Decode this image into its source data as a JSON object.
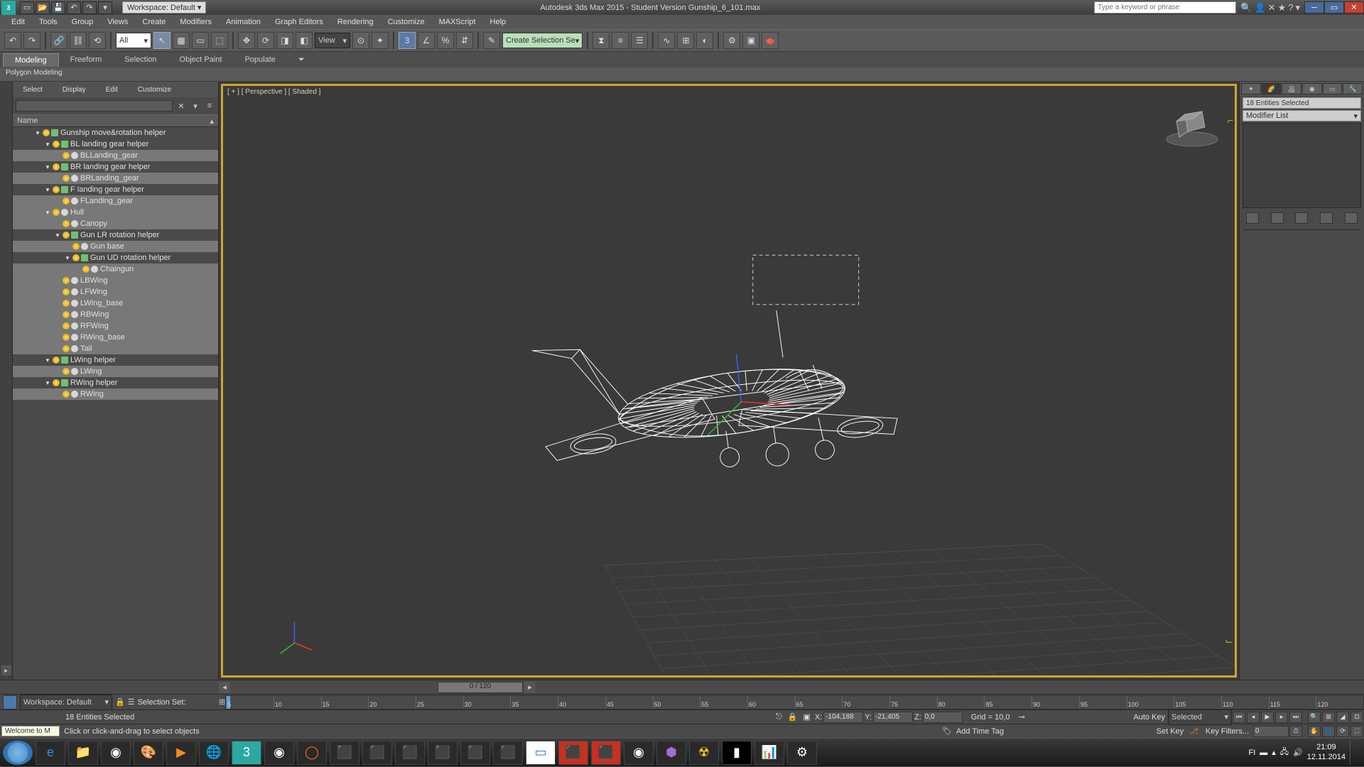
{
  "titlebar": {
    "workspace_label": "Workspace: Default",
    "title": "Autodesk 3ds Max 2015  -  Student Version    Gunship_6_101.max",
    "search_placeholder": "Type a keyword or phrase"
  },
  "menubar": [
    "Edit",
    "Tools",
    "Group",
    "Views",
    "Create",
    "Modifiers",
    "Animation",
    "Graph Editors",
    "Rendering",
    "Customize",
    "MAXScript",
    "Help"
  ],
  "maintoolbar": {
    "filter_combo": "All",
    "ref_combo": "View",
    "selset_combo": "Create Selection Se"
  },
  "ribbon": {
    "tabs": [
      "Modeling",
      "Freeform",
      "Selection",
      "Object Paint",
      "Populate"
    ],
    "subpanel": "Polygon Modeling"
  },
  "scene_explorer": {
    "tabs": [
      "Select",
      "Display",
      "Edit",
      "Customize"
    ],
    "header": "Name",
    "tree": [
      {
        "d": 0,
        "exp": "▾",
        "ico": "helper",
        "sel": false,
        "label": "Gunship move&rotation helper"
      },
      {
        "d": 1,
        "exp": "▾",
        "ico": "helper",
        "sel": false,
        "label": "BL landing gear helper"
      },
      {
        "d": 2,
        "exp": "",
        "ico": "geom",
        "sel": true,
        "label": "BLLanding_gear"
      },
      {
        "d": 1,
        "exp": "▾",
        "ico": "helper",
        "sel": false,
        "label": "BR landing gear helper"
      },
      {
        "d": 2,
        "exp": "",
        "ico": "geom",
        "sel": true,
        "label": "BRLanding_gear"
      },
      {
        "d": 1,
        "exp": "▾",
        "ico": "helper",
        "sel": false,
        "label": "F landing gear helper"
      },
      {
        "d": 2,
        "exp": "",
        "ico": "geom",
        "sel": true,
        "label": "FLanding_gear"
      },
      {
        "d": 1,
        "exp": "▾",
        "ico": "geom",
        "sel": true,
        "label": "Hull"
      },
      {
        "d": 2,
        "exp": "",
        "ico": "geom",
        "sel": true,
        "label": "Canopy"
      },
      {
        "d": 2,
        "exp": "▾",
        "ico": "helper",
        "sel": false,
        "label": "Gun LR rotation helper"
      },
      {
        "d": 3,
        "exp": "",
        "ico": "geom",
        "sel": true,
        "label": "Gun base"
      },
      {
        "d": 3,
        "exp": "▾",
        "ico": "helper",
        "sel": false,
        "label": "Gun UD rotation helper"
      },
      {
        "d": 4,
        "exp": "",
        "ico": "geom",
        "sel": true,
        "label": "Chaingun"
      },
      {
        "d": 2,
        "exp": "",
        "ico": "geom",
        "sel": true,
        "label": "LBWing"
      },
      {
        "d": 2,
        "exp": "",
        "ico": "geom",
        "sel": true,
        "label": "LFWing"
      },
      {
        "d": 2,
        "exp": "",
        "ico": "geom",
        "sel": true,
        "label": "LWing_base"
      },
      {
        "d": 2,
        "exp": "",
        "ico": "geom",
        "sel": true,
        "label": "RBWing"
      },
      {
        "d": 2,
        "exp": "",
        "ico": "geom",
        "sel": true,
        "label": "RFWing"
      },
      {
        "d": 2,
        "exp": "",
        "ico": "geom",
        "sel": true,
        "label": "RWing_base"
      },
      {
        "d": 2,
        "exp": "",
        "ico": "geom",
        "sel": true,
        "label": "Tail"
      },
      {
        "d": 1,
        "exp": "▾",
        "ico": "helper",
        "sel": false,
        "label": "LWing helper"
      },
      {
        "d": 2,
        "exp": "",
        "ico": "geom",
        "sel": true,
        "label": "LWing"
      },
      {
        "d": 1,
        "exp": "▾",
        "ico": "helper",
        "sel": false,
        "label": "RWing helper"
      },
      {
        "d": 2,
        "exp": "",
        "ico": "geom",
        "sel": true,
        "label": "RWing"
      }
    ]
  },
  "viewport": {
    "label": "[ + ] [ Perspective ] [ Shaded ]"
  },
  "command_panel": {
    "selection_info": "18 Entities Selected",
    "modifier_label": "Modifier List"
  },
  "timeline": {
    "slider_text": "0 / 120",
    "ticks": [
      5,
      10,
      15,
      20,
      25,
      30,
      35,
      40,
      45,
      50,
      55,
      60,
      65,
      70,
      75,
      80,
      85,
      90,
      95,
      100,
      105,
      110,
      115,
      120
    ]
  },
  "lower": {
    "workspace": "Workspace: Default",
    "selset_label": "Selection Set:"
  },
  "statusbar": {
    "welcome": "Welcome to M",
    "selected": "18 Entities Selected",
    "prompt": "Click or click-and-drag to select objects",
    "x": "-104,188",
    "y": "-21,405",
    "z": "0,0",
    "grid": "Grid = 10,0",
    "autokey": "Auto Key",
    "setkey": "Set Key",
    "keymode": "Selected",
    "keyfilters": "Key Filters...",
    "addtime": "Add Time Tag"
  },
  "taskbar": {
    "lang": "FI",
    "time": "21:09",
    "date": "12.11.2014"
  }
}
